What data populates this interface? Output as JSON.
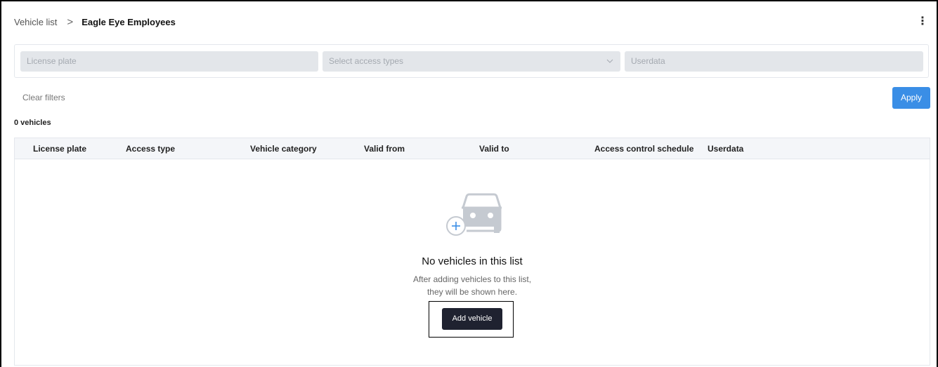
{
  "breadcrumb": {
    "parent": "Vehicle list",
    "separator": ">",
    "current": "Eagle Eye Employees"
  },
  "menu_icon": "⋮",
  "filters": {
    "license_plate_placeholder": "License plate",
    "access_types_placeholder": "Select access types",
    "userdata_placeholder": "Userdata",
    "clear_label": "Clear filters",
    "apply_label": "Apply"
  },
  "vehicle_count": "0 vehicles",
  "table": {
    "columns": [
      "License plate",
      "Access type",
      "Vehicle category",
      "Valid from",
      "Valid to",
      "Access control schedule",
      "Userdata"
    ]
  },
  "empty_state": {
    "title": "No vehicles in this list",
    "line1": "After adding vehicles to this list,",
    "line2": "they will be shown here.",
    "add_label": "Add vehicle"
  },
  "icons": {
    "menu": "kebab-menu-icon",
    "dropdown": "chevron-down-icon",
    "empty": "car-add-icon"
  },
  "colors": {
    "apply": "#3a8ee6",
    "add_button": "#1f2230",
    "input_bg": "#e3e6ea",
    "header_bg": "#f4f6f9"
  }
}
